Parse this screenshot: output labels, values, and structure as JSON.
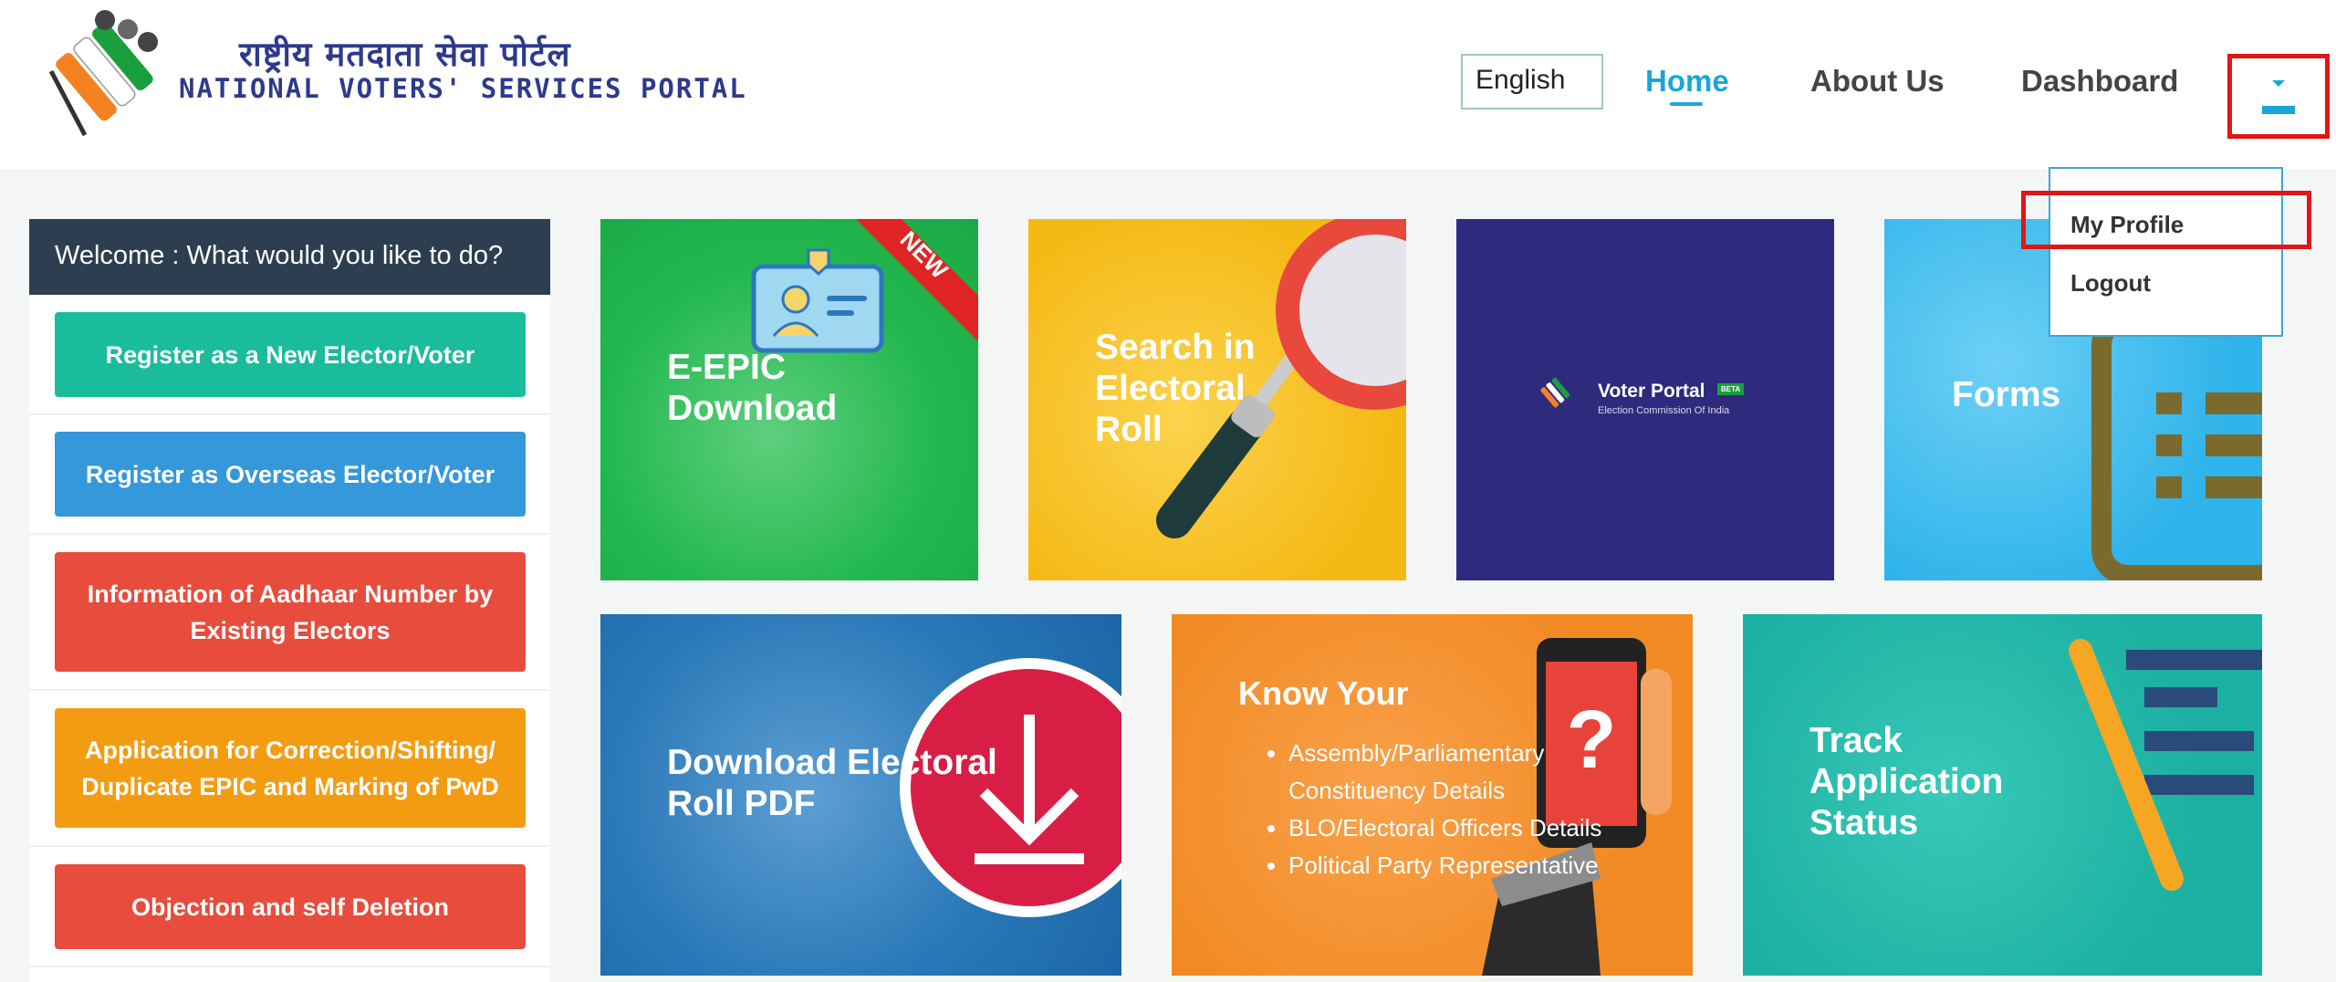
{
  "header": {
    "title_hindi": "राष्ट्रीय मतदाता सेवा पोर्टल",
    "title_english": "NATIONAL VOTERS' SERVICES PORTAL",
    "language": "English",
    "nav": {
      "home": "Home",
      "about": "About Us",
      "dashboard": "Dashboard"
    },
    "accent_color": "#1aa6d8"
  },
  "dropdown": {
    "my_profile": "My Profile",
    "logout": "Logout"
  },
  "sidebar": {
    "heading": "Welcome : What would you like to do?",
    "buttons": [
      {
        "label": "Register as a New Elector/Voter",
        "color": "#1abc9c"
      },
      {
        "label": "Register as Overseas Elector/Voter",
        "color": "#3498db"
      },
      {
        "label": "Information of Aadhaar Number by Existing Electors",
        "color": "#e74c3c"
      },
      {
        "label": "Application for Correction/Shifting/ Duplicate EPIC and Marking of PwD",
        "color": "#f39c12"
      },
      {
        "label": "Objection and self Deletion",
        "color": "#e74c3c"
      }
    ]
  },
  "tiles": {
    "epic": {
      "label": "E-EPIC Download",
      "badge": "NEW"
    },
    "search": {
      "label": "Search in Electoral Roll"
    },
    "voter_portal": {
      "title": "Voter Portal",
      "badge": "BETA",
      "subtitle": "Election Commission Of India"
    },
    "forms": {
      "label": "Forms"
    },
    "download_pdf": {
      "label": "Download Electoral Roll PDF"
    },
    "know_your": {
      "title": "Know Your",
      "items": [
        "Assembly/Parliamentary Constituency Details",
        "BLO/Electoral Officers Details",
        "Political Party Representative"
      ]
    },
    "track": {
      "label": "Track Application Status"
    }
  }
}
